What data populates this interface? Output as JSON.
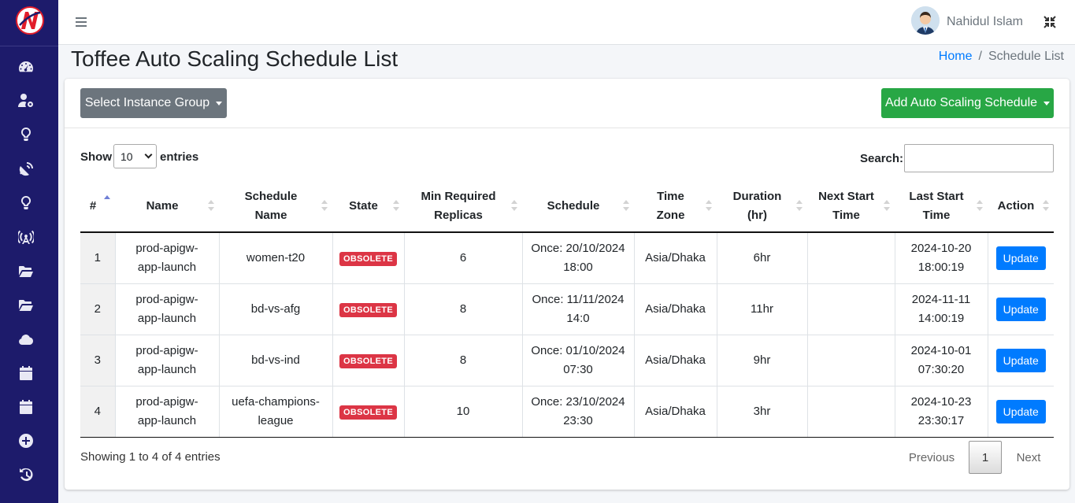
{
  "user": {
    "name": "Nahidul Islam"
  },
  "page": {
    "title": "Toffee Auto Scaling Schedule List"
  },
  "breadcrumb": {
    "home": "Home",
    "separator": "/",
    "current": "Schedule List"
  },
  "toolbar": {
    "select_group_label": "Select Instance Group",
    "add_schedule_label": "Add Auto Scaling Schedule"
  },
  "table_controls": {
    "show_label": "Show",
    "page_length": "10",
    "entries_label": "entries",
    "search_label": "Search:",
    "search_value": ""
  },
  "columns": [
    [
      "#"
    ],
    [
      "Name"
    ],
    [
      "Schedule",
      "Name"
    ],
    [
      "State"
    ],
    [
      "Min Required",
      "Replicas"
    ],
    [
      "Schedule"
    ],
    [
      "Time",
      "Zone"
    ],
    [
      "Duration",
      "(hr)"
    ],
    [
      "Next Start",
      "Time"
    ],
    [
      "Last Start",
      "Time"
    ],
    [
      "Action"
    ]
  ],
  "rows": [
    {
      "num": "1",
      "name": [
        "prod-apigw-",
        "app-launch"
      ],
      "schedule_name": [
        "women-t20"
      ],
      "state": "OBSOLETE",
      "min_replicas": "6",
      "schedule": [
        "Once: 20/10/2024",
        "18:00"
      ],
      "time_zone": "Asia/Dhaka",
      "duration": "6hr",
      "next_start": "",
      "last_start": [
        "2024-10-20",
        "18:00:19"
      ],
      "action": "Update"
    },
    {
      "num": "2",
      "name": [
        "prod-apigw-",
        "app-launch"
      ],
      "schedule_name": [
        "bd-vs-afg"
      ],
      "state": "OBSOLETE",
      "min_replicas": "8",
      "schedule": [
        "Once: 11/11/2024",
        "14:0"
      ],
      "time_zone": "Asia/Dhaka",
      "duration": "11hr",
      "next_start": "",
      "last_start": [
        "2024-11-11",
        "14:00:19"
      ],
      "action": "Update"
    },
    {
      "num": "3",
      "name": [
        "prod-apigw-",
        "app-launch"
      ],
      "schedule_name": [
        "bd-vs-ind"
      ],
      "state": "OBSOLETE",
      "min_replicas": "8",
      "schedule": [
        "Once: 01/10/2024",
        "07:30"
      ],
      "time_zone": "Asia/Dhaka",
      "duration": "9hr",
      "next_start": "",
      "last_start": [
        "2024-10-01",
        "07:30:20"
      ],
      "action": "Update"
    },
    {
      "num": "4",
      "name": [
        "prod-apigw-",
        "app-launch"
      ],
      "schedule_name": [
        "uefa-champions-",
        "league"
      ],
      "state": "OBSOLETE",
      "min_replicas": "10",
      "schedule": [
        "Once: 23/10/2024",
        "23:30"
      ],
      "time_zone": "Asia/Dhaka",
      "duration": "3hr",
      "next_start": "",
      "last_start": [
        "2024-10-23",
        "23:30:17"
      ],
      "action": "Update"
    }
  ],
  "footer": {
    "info": "Showing 1 to 4 of 4 entries",
    "previous": "Previous",
    "current_page": "1",
    "next": "Next"
  },
  "sidebar_icons": [
    "dashboard-icon",
    "user-gear-icon",
    "lightbulb-icon",
    "satellite-dish-icon",
    "lightbulb-icon",
    "broadcast-tower-icon",
    "folder-open-icon",
    "folder-open-icon",
    "cloud-icon",
    "calendar-icon",
    "calendar-icon",
    "plus-circle-icon",
    "history-icon"
  ],
  "colors": {
    "sidebar": "#1d1b6b",
    "primary": "#007bff",
    "success": "#28a745",
    "danger": "#dc3545",
    "secondary": "#6c757d"
  }
}
